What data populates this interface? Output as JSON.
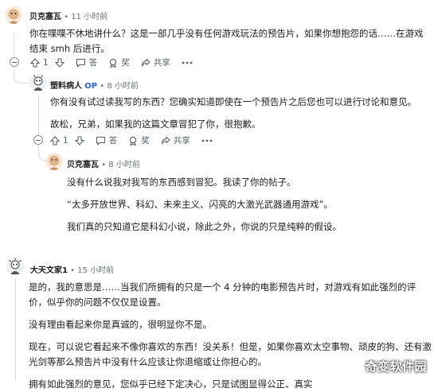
{
  "comments": [
    {
      "author": "贝克塞瓦",
      "time": "11 小时前",
      "body": [
        "你在喋喋不休地讲什么？这是一部几乎没有任何游戏玩法的预告片，如果你想抱怨的话……在游戏结束 smh 后进行。"
      ],
      "votes": "1",
      "answer_label": "答",
      "award_label": "奖",
      "share_label": "共享"
    },
    {
      "author": "塑料病人",
      "op_badge": "OP",
      "time": "8 小时前",
      "body": [
        "你有没有试过读我写的东西？您确实知道即使在一个预告片之后您也可以进行讨论和意见。",
        "故松，兄弟，如果我的这篇文章冒犯了你，很抱歉。"
      ],
      "votes": "1",
      "answer_label": "答",
      "award_label": "奖",
      "share_label": "共享"
    },
    {
      "author": "贝克塞瓦",
      "time": "8 小时前",
      "body": [
        "没有什么说我对我写的东西感到冒犯。我读了你的帖子。",
        "“太多开放世界、科幻、未来主义、闪亮的大激光武器通用游戏”。",
        "我们真的只知道它是科幻小说，除此之外，你说的只是纯粹的假设。"
      ]
    },
    {
      "author": "大天文家1",
      "time": "15 小时前",
      "body": [
        "是的，我的意思是……当我们所拥有的只是一个 4 分钟的电影预告片时，对游戏有如此强烈的评价，似乎你的问题不仅仅是设置。",
        "没有理由看起来你是真诚的，很明显你不是。",
        "现在，可以说它看起来不像你喜欢的东西！没关系！但是，如果你喜欢太空事物、顽皮的狗、还有激光剑等那么预告片中没有什么应该让你退缩或让你担心的。",
        "拥有如此强烈的意见，您似乎已经下定决心，只是试图显得公正、真实"
      ]
    }
  ],
  "separator": "•",
  "watermark": "奇变软件园",
  "icons": [
    "avatar-icon",
    "upvote-icon",
    "downvote-icon",
    "reply-icon",
    "award-icon",
    "share-icon",
    "collapse-icon",
    "more-icon"
  ]
}
